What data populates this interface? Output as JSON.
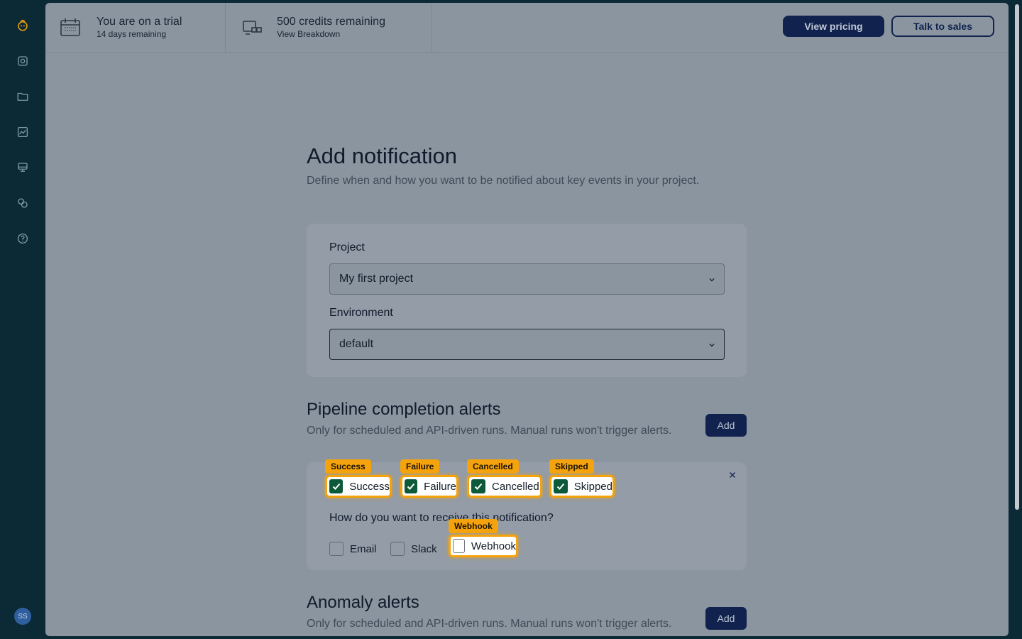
{
  "sidebar": {
    "avatar_initials": "SS",
    "icons": [
      "logo-icon",
      "scan-icon",
      "folder-icon",
      "chart-icon",
      "server-icon",
      "integrations-icon",
      "help-icon"
    ]
  },
  "topbar": {
    "trial_title": "You are on a trial",
    "trial_sub": "14 days remaining",
    "credits_title": "500 credits remaining",
    "credits_sub": "View Breakdown",
    "view_pricing": "View pricing",
    "talk_to_sales": "Talk to sales"
  },
  "page": {
    "title": "Add notification",
    "subtitle": "Define when and how you want to be notified about key events in your project."
  },
  "form": {
    "project_label": "Project",
    "project_value": "My first project",
    "environment_label": "Environment",
    "environment_value": "default"
  },
  "pipeline": {
    "title": "Pipeline completion alerts",
    "subtitle": "Only for scheduled and API-driven runs. Manual runs won't trigger alerts.",
    "add_label": "Add",
    "statuses": [
      {
        "label": "Success",
        "tag": "Success",
        "checked": true
      },
      {
        "label": "Failure",
        "tag": "Failure",
        "checked": true
      },
      {
        "label": "Cancelled",
        "tag": "Cancelled",
        "checked": true
      },
      {
        "label": "Skipped",
        "tag": "Skipped",
        "checked": true
      }
    ],
    "question": "How do you want to receive this notification?",
    "channels": [
      {
        "label": "Email",
        "checked": false
      },
      {
        "label": "Slack",
        "checked": false
      },
      {
        "label": "Webhook",
        "tag": "Webhook",
        "checked": false
      }
    ]
  },
  "anomaly": {
    "title": "Anomaly alerts",
    "subtitle": "Only for scheduled and API-driven runs. Manual runs won't trigger alerts.",
    "add_label": "Add"
  },
  "colors": {
    "accent": "#f5a30c",
    "primary": "#10224d",
    "check": "#0d5a3a"
  }
}
